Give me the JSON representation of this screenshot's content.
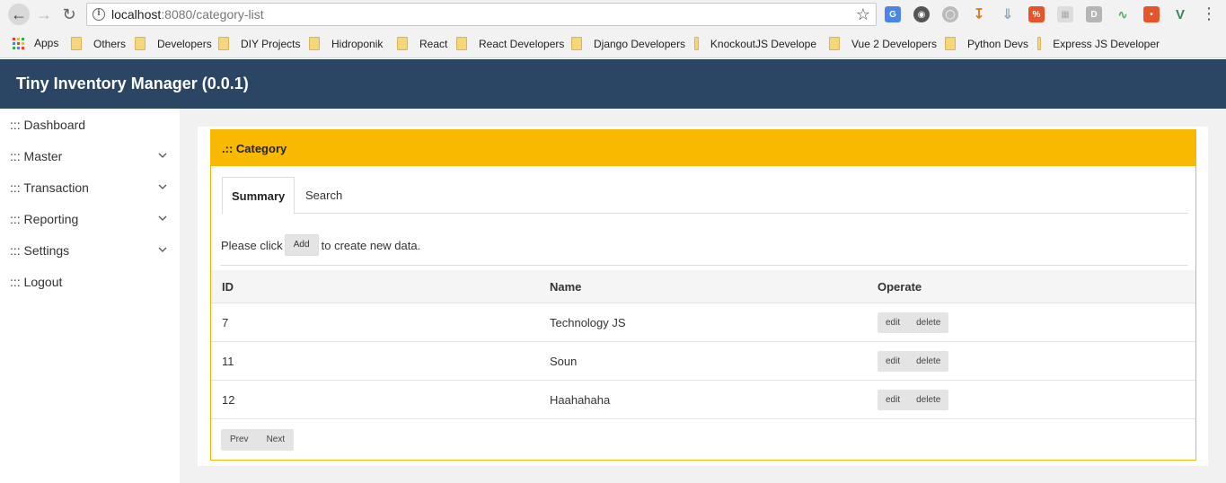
{
  "browser": {
    "url_host": "localhost",
    "url_rest": ":8080/category-list"
  },
  "bookmarks": [
    {
      "label": "Apps",
      "kind": "apps"
    },
    {
      "label": "Others",
      "kind": "folder"
    },
    {
      "label": "Developers",
      "kind": "folder"
    },
    {
      "label": "DIY Projects",
      "kind": "folder"
    },
    {
      "label": "Hidroponik",
      "kind": "folder"
    },
    {
      "label": "React",
      "kind": "folder"
    },
    {
      "label": "React Developers",
      "kind": "folder"
    },
    {
      "label": "Django Developers",
      "kind": "folder"
    },
    {
      "label": "KnockoutJS Develope",
      "kind": "folder"
    },
    {
      "label": "Vue 2 Developers",
      "kind": "folder"
    },
    {
      "label": "Python Devs",
      "kind": "folder"
    },
    {
      "label": "Express JS Developer",
      "kind": "folder"
    }
  ],
  "app": {
    "title": "Tiny Inventory Manager (0.0.1)"
  },
  "sidebar": {
    "items": [
      {
        "label": "::: Dashboard",
        "has_submenu": false
      },
      {
        "label": "::: Master",
        "has_submenu": true
      },
      {
        "label": "::: Transaction",
        "has_submenu": true
      },
      {
        "label": "::: Reporting",
        "has_submenu": true
      },
      {
        "label": "::: Settings",
        "has_submenu": true
      },
      {
        "label": "::: Logout",
        "has_submenu": false
      }
    ]
  },
  "card": {
    "title": ".:: Category",
    "tabs": [
      {
        "label": "Summary",
        "active": true
      },
      {
        "label": "Search",
        "active": false
      }
    ],
    "notice_prefix": "Please click",
    "add_label": "Add",
    "notice_suffix": "to create new data."
  },
  "table": {
    "headers": [
      "ID",
      "Name",
      "Operate"
    ],
    "rows": [
      {
        "id": "7",
        "name": "Technology JS"
      },
      {
        "id": "11",
        "name": "Soun"
      },
      {
        "id": "12",
        "name": "Haahahaha"
      }
    ],
    "edit_label": "edit",
    "delete_label": "delete"
  },
  "pager": {
    "prev_label": "Prev",
    "next_label": "Next"
  },
  "colors": {
    "header_bg": "#2b4564",
    "card_accent": "#f9b900",
    "main_bg": "#f1f1f1"
  }
}
